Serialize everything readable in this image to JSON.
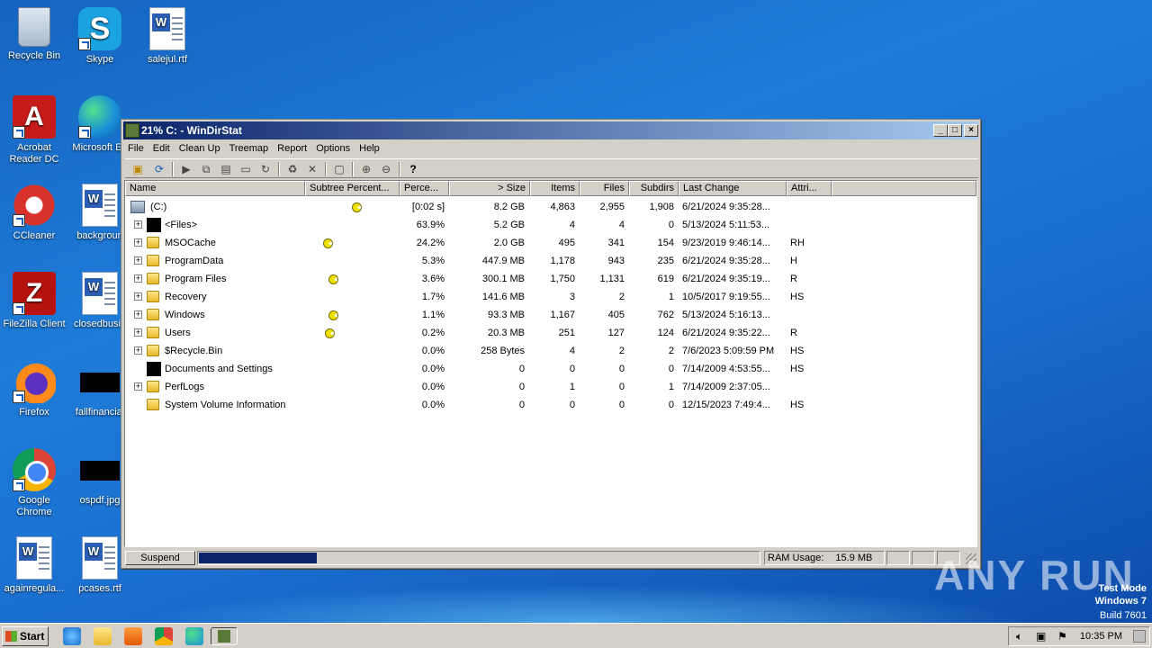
{
  "desktop": {
    "icons": [
      {
        "label": "Recycle Bin",
        "icon": "recycle-bin-icon"
      },
      {
        "label": "Skype",
        "icon": "skype-icon"
      },
      {
        "label": "salejul.rtf",
        "icon": "word-document-icon"
      },
      {
        "label": "Acrobat Reader DC",
        "icon": "acrobat-icon"
      },
      {
        "label": "Microsoft Ed",
        "icon": "edge-icon"
      },
      {
        "label": "CCleaner",
        "icon": "ccleaner-icon"
      },
      {
        "label": "backgroun",
        "icon": "word-document-icon"
      },
      {
        "label": "FileZilla Client",
        "icon": "filezilla-icon"
      },
      {
        "label": "closedbusin",
        "icon": "word-document-icon"
      },
      {
        "label": "Firefox",
        "icon": "firefox-icon"
      },
      {
        "label": "fallfinancial",
        "icon": "black-thumbnail-icon"
      },
      {
        "label": "Google Chrome",
        "icon": "chrome-icon"
      },
      {
        "label": "ospdf.jpg",
        "icon": "black-thumbnail-icon"
      },
      {
        "label": "againregula...",
        "icon": "word-document-icon"
      },
      {
        "label": "pcases.rtf",
        "icon": "word-document-icon"
      }
    ]
  },
  "window": {
    "title": "21% C: - WinDirStat",
    "controls": {
      "minimize": "_",
      "maximize": "□",
      "close": "×"
    }
  },
  "menu": [
    "File",
    "Edit",
    "Clean Up",
    "Treemap",
    "Report",
    "Options",
    "Help"
  ],
  "columns": [
    "Name",
    "Subtree Percent...",
    "Perce...",
    "> Size",
    "Items",
    "Files",
    "Subdirs",
    "Last Change",
    "Attri..."
  ],
  "rows": [
    {
      "name": "(C:)",
      "perc": "[0:02 s]",
      "size": "8.2 GB",
      "items": "4,863",
      "files": "2,955",
      "subdirs": "1,908",
      "change": "6/21/2024  9:35:28...",
      "attr": "",
      "subtree": 100,
      "icon": "drive"
    },
    {
      "name": "<Files>",
      "perc": "63.9%",
      "size": "5.2 GB",
      "items": "4",
      "files": "4",
      "subdirs": "0",
      "change": "5/13/2024  5:11:53...",
      "attr": "",
      "subtree": 63.9,
      "icon": "files"
    },
    {
      "name": "MSOCache",
      "perc": "24.2%",
      "size": "2.0 GB",
      "items": "495",
      "files": "341",
      "subdirs": "154",
      "change": "9/23/2019  9:46:14...",
      "attr": "RH",
      "subtree": 24.2,
      "icon": "folder"
    },
    {
      "name": "ProgramData",
      "perc": "5.3%",
      "size": "447.9 MB",
      "items": "1,178",
      "files": "943",
      "subdirs": "235",
      "change": "6/21/2024  9:35:28...",
      "attr": "H",
      "subtree": 5.3,
      "icon": "folder"
    },
    {
      "name": "Program Files",
      "perc": "3.6%",
      "size": "300.1 MB",
      "items": "1,750",
      "files": "1,131",
      "subdirs": "619",
      "change": "6/21/2024  9:35:19...",
      "attr": "R",
      "subtree": 3.6,
      "icon": "folder"
    },
    {
      "name": "Recovery",
      "perc": "1.7%",
      "size": "141.6 MB",
      "items": "3",
      "files": "2",
      "subdirs": "1",
      "change": "10/5/2017  9:19:55...",
      "attr": "HS",
      "subtree": 1.7,
      "icon": "folder"
    },
    {
      "name": "Windows",
      "perc": "1.1%",
      "size": "93.3 MB",
      "items": "1,167",
      "files": "405",
      "subdirs": "762",
      "change": "5/13/2024  5:16:13...",
      "attr": "",
      "subtree": 1.1,
      "icon": "folder"
    },
    {
      "name": "Users",
      "perc": "0.2%",
      "size": "20.3 MB",
      "items": "251",
      "files": "127",
      "subdirs": "124",
      "change": "6/21/2024  9:35:22...",
      "attr": "R",
      "subtree": 0.2,
      "icon": "folder"
    },
    {
      "name": "$Recycle.Bin",
      "perc": "0.0%",
      "size": "258 Bytes",
      "items": "4",
      "files": "2",
      "subdirs": "2",
      "change": "7/6/2023  5:09:59 PM",
      "attr": "HS",
      "subtree": 0,
      "icon": "folder"
    },
    {
      "name": "Documents and Settings",
      "perc": "0.0%",
      "size": "0",
      "items": "0",
      "files": "0",
      "subdirs": "0",
      "change": "7/14/2009  4:53:55...",
      "attr": "HS",
      "subtree": 0,
      "icon": "files"
    },
    {
      "name": "PerfLogs",
      "perc": "0.0%",
      "size": "0",
      "items": "1",
      "files": "0",
      "subdirs": "1",
      "change": "7/14/2009  2:37:05...",
      "attr": "",
      "subtree": 0,
      "icon": "folder"
    },
    {
      "name": "System Volume Information",
      "perc": "0.0%",
      "size": "0",
      "items": "0",
      "files": "0",
      "subdirs": "0",
      "change": "12/15/2023  7:49:4...",
      "attr": "HS",
      "subtree": 0,
      "icon": "folder"
    }
  ],
  "status": {
    "suspend_label": "Suspend",
    "progress": 0.21,
    "ram_label": "RAM Usage:",
    "ram_value": "15.9 MB"
  },
  "taskbar": {
    "start_label": "Start",
    "clock": "10:35 PM"
  },
  "watermark": {
    "line1": "Test Mode",
    "line2": "Windows 7",
    "line3": "Build 7601",
    "brand": "ANY RUN"
  },
  "colors": {
    "title_start": "#0a246a",
    "title_end": "#a6caf0",
    "progress": "#0a246a",
    "pacman": "#f0e000"
  }
}
